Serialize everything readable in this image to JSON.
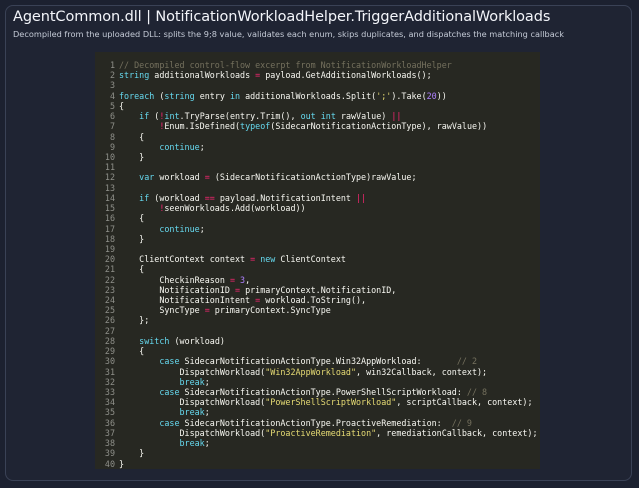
{
  "header": {
    "title": "AgentCommon.dll  |  NotificationWorkloadHelper.TriggerAdditionalWorkloads",
    "subtitle": "Decompiled from the uploaded DLL: splits the 9;8 value, validates each enum, skips duplicates, and dispatches the matching callback"
  },
  "theme": {
    "page_background": "#1c2130",
    "code_background": "#272822",
    "comment": "#75715e",
    "keyword": "#66d9ef",
    "string": "#e6db74",
    "number": "#ae81ff",
    "operator": "#f92672",
    "plain": "#f8f8f2",
    "line_number": "#8f908a"
  },
  "code": {
    "lines": [
      {
        "n": "1",
        "tokens": [
          {
            "t": "// Decompiled control-flow excerpt from NotificationWorkloadHelper",
            "k": "comment"
          }
        ]
      },
      {
        "n": "2",
        "tokens": [
          {
            "t": "string",
            "k": "keyword"
          },
          {
            "t": " additionalWorkloads ",
            "k": "plain"
          },
          {
            "t": "=",
            "k": "operator"
          },
          {
            "t": " payload.GetAdditionalWorkloads();",
            "k": "plain"
          }
        ]
      },
      {
        "n": "3",
        "tokens": []
      },
      {
        "n": "4",
        "tokens": [
          {
            "t": "foreach",
            "k": "keyword"
          },
          {
            "t": " (",
            "k": "plain"
          },
          {
            "t": "string",
            "k": "keyword"
          },
          {
            "t": " entry ",
            "k": "plain"
          },
          {
            "t": "in",
            "k": "keyword"
          },
          {
            "t": " additionalWorkloads.Split(",
            "k": "plain"
          },
          {
            "t": "';'",
            "k": "string"
          },
          {
            "t": ").Take(",
            "k": "plain"
          },
          {
            "t": "20",
            "k": "number"
          },
          {
            "t": "))",
            "k": "plain"
          }
        ]
      },
      {
        "n": "5",
        "tokens": [
          {
            "t": "{",
            "k": "plain"
          }
        ]
      },
      {
        "n": "6",
        "tokens": [
          {
            "t": "    ",
            "k": "plain"
          },
          {
            "t": "if",
            "k": "keyword"
          },
          {
            "t": " (",
            "k": "plain"
          },
          {
            "t": "!",
            "k": "operator"
          },
          {
            "t": "int",
            "k": "keyword"
          },
          {
            "t": ".TryParse(entry.Trim(), ",
            "k": "plain"
          },
          {
            "t": "out",
            "k": "keyword"
          },
          {
            "t": " ",
            "k": "plain"
          },
          {
            "t": "int",
            "k": "keyword"
          },
          {
            "t": " rawValue) ",
            "k": "plain"
          },
          {
            "t": "||",
            "k": "operator"
          }
        ]
      },
      {
        "n": "7",
        "tokens": [
          {
            "t": "        ",
            "k": "plain"
          },
          {
            "t": "!",
            "k": "operator"
          },
          {
            "t": "Enum.IsDefined(",
            "k": "plain"
          },
          {
            "t": "typeof",
            "k": "keyword"
          },
          {
            "t": "(SidecarNotificationActionType), rawValue))",
            "k": "plain"
          }
        ]
      },
      {
        "n": "8",
        "tokens": [
          {
            "t": "    {",
            "k": "plain"
          }
        ]
      },
      {
        "n": "9",
        "tokens": [
          {
            "t": "        ",
            "k": "plain"
          },
          {
            "t": "continue",
            "k": "keyword"
          },
          {
            "t": ";",
            "k": "plain"
          }
        ]
      },
      {
        "n": "10",
        "tokens": [
          {
            "t": "    }",
            "k": "plain"
          }
        ]
      },
      {
        "n": "11",
        "tokens": []
      },
      {
        "n": "12",
        "tokens": [
          {
            "t": "    ",
            "k": "plain"
          },
          {
            "t": "var",
            "k": "keyword"
          },
          {
            "t": " workload ",
            "k": "plain"
          },
          {
            "t": "=",
            "k": "operator"
          },
          {
            "t": " (SidecarNotificationActionType)rawValue;",
            "k": "plain"
          }
        ]
      },
      {
        "n": "13",
        "tokens": []
      },
      {
        "n": "14",
        "tokens": [
          {
            "t": "    ",
            "k": "plain"
          },
          {
            "t": "if",
            "k": "keyword"
          },
          {
            "t": " (workload ",
            "k": "plain"
          },
          {
            "t": "==",
            "k": "operator"
          },
          {
            "t": " payload.NotificationIntent ",
            "k": "plain"
          },
          {
            "t": "||",
            "k": "operator"
          }
        ]
      },
      {
        "n": "15",
        "tokens": [
          {
            "t": "        ",
            "k": "plain"
          },
          {
            "t": "!",
            "k": "operator"
          },
          {
            "t": "seenWorkloads.Add(workload))",
            "k": "plain"
          }
        ]
      },
      {
        "n": "16",
        "tokens": [
          {
            "t": "    {",
            "k": "plain"
          }
        ]
      },
      {
        "n": "17",
        "tokens": [
          {
            "t": "        ",
            "k": "plain"
          },
          {
            "t": "continue",
            "k": "keyword"
          },
          {
            "t": ";",
            "k": "plain"
          }
        ]
      },
      {
        "n": "18",
        "tokens": [
          {
            "t": "    }",
            "k": "plain"
          }
        ]
      },
      {
        "n": "19",
        "tokens": []
      },
      {
        "n": "20",
        "tokens": [
          {
            "t": "    ClientContext context ",
            "k": "plain"
          },
          {
            "t": "=",
            "k": "operator"
          },
          {
            "t": " ",
            "k": "plain"
          },
          {
            "t": "new",
            "k": "keyword"
          },
          {
            "t": " ClientContext",
            "k": "plain"
          }
        ]
      },
      {
        "n": "21",
        "tokens": [
          {
            "t": "    {",
            "k": "plain"
          }
        ]
      },
      {
        "n": "22",
        "tokens": [
          {
            "t": "        CheckinReason ",
            "k": "plain"
          },
          {
            "t": "=",
            "k": "operator"
          },
          {
            "t": " ",
            "k": "plain"
          },
          {
            "t": "3",
            "k": "number"
          },
          {
            "t": ",",
            "k": "plain"
          }
        ]
      },
      {
        "n": "23",
        "tokens": [
          {
            "t": "        NotificationID ",
            "k": "plain"
          },
          {
            "t": "=",
            "k": "operator"
          },
          {
            "t": " primaryContext.NotificationID,",
            "k": "plain"
          }
        ]
      },
      {
        "n": "24",
        "tokens": [
          {
            "t": "        NotificationIntent ",
            "k": "plain"
          },
          {
            "t": "=",
            "k": "operator"
          },
          {
            "t": " workload.ToString(),",
            "k": "plain"
          }
        ]
      },
      {
        "n": "25",
        "tokens": [
          {
            "t": "        SyncType ",
            "k": "plain"
          },
          {
            "t": "=",
            "k": "operator"
          },
          {
            "t": " primaryContext.SyncType",
            "k": "plain"
          }
        ]
      },
      {
        "n": "26",
        "tokens": [
          {
            "t": "    };",
            "k": "plain"
          }
        ]
      },
      {
        "n": "27",
        "tokens": []
      },
      {
        "n": "28",
        "tokens": [
          {
            "t": "    ",
            "k": "plain"
          },
          {
            "t": "switch",
            "k": "keyword"
          },
          {
            "t": " (workload)",
            "k": "plain"
          }
        ]
      },
      {
        "n": "29",
        "tokens": [
          {
            "t": "    {",
            "k": "plain"
          }
        ]
      },
      {
        "n": "30",
        "tokens": [
          {
            "t": "        ",
            "k": "plain"
          },
          {
            "t": "case",
            "k": "keyword"
          },
          {
            "t": " SidecarNotificationActionType.Win32AppWorkload:       ",
            "k": "plain"
          },
          {
            "t": "// 2",
            "k": "comment"
          }
        ]
      },
      {
        "n": "31",
        "tokens": [
          {
            "t": "            DispatchWorkload(",
            "k": "plain"
          },
          {
            "t": "\"Win32AppWorkload\"",
            "k": "string"
          },
          {
            "t": ", win32Callback, context);",
            "k": "plain"
          }
        ]
      },
      {
        "n": "32",
        "tokens": [
          {
            "t": "            ",
            "k": "plain"
          },
          {
            "t": "break",
            "k": "keyword"
          },
          {
            "t": ";",
            "k": "plain"
          }
        ]
      },
      {
        "n": "33",
        "tokens": [
          {
            "t": "        ",
            "k": "plain"
          },
          {
            "t": "case",
            "k": "keyword"
          },
          {
            "t": " SidecarNotificationActionType.PowerShellScriptWorkload: ",
            "k": "plain"
          },
          {
            "t": "// 8",
            "k": "comment"
          }
        ]
      },
      {
        "n": "34",
        "tokens": [
          {
            "t": "            DispatchWorkload(",
            "k": "plain"
          },
          {
            "t": "\"PowerShellScriptWorkload\"",
            "k": "string"
          },
          {
            "t": ", scriptCallback, context);",
            "k": "plain"
          }
        ]
      },
      {
        "n": "35",
        "tokens": [
          {
            "t": "            ",
            "k": "plain"
          },
          {
            "t": "break",
            "k": "keyword"
          },
          {
            "t": ";",
            "k": "plain"
          }
        ]
      },
      {
        "n": "36",
        "tokens": [
          {
            "t": "        ",
            "k": "plain"
          },
          {
            "t": "case",
            "k": "keyword"
          },
          {
            "t": " SidecarNotificationActionType.ProactiveRemediation:  ",
            "k": "plain"
          },
          {
            "t": "// 9",
            "k": "comment"
          }
        ]
      },
      {
        "n": "37",
        "tokens": [
          {
            "t": "            DispatchWorkload(",
            "k": "plain"
          },
          {
            "t": "\"ProactiveRemediation\"",
            "k": "string"
          },
          {
            "t": ", remediationCallback, context);",
            "k": "plain"
          }
        ]
      },
      {
        "n": "38",
        "tokens": [
          {
            "t": "            ",
            "k": "plain"
          },
          {
            "t": "break",
            "k": "keyword"
          },
          {
            "t": ";",
            "k": "plain"
          }
        ]
      },
      {
        "n": "39",
        "tokens": [
          {
            "t": "    }",
            "k": "plain"
          }
        ]
      },
      {
        "n": "40",
        "tokens": [
          {
            "t": "}",
            "k": "plain"
          }
        ]
      }
    ]
  }
}
